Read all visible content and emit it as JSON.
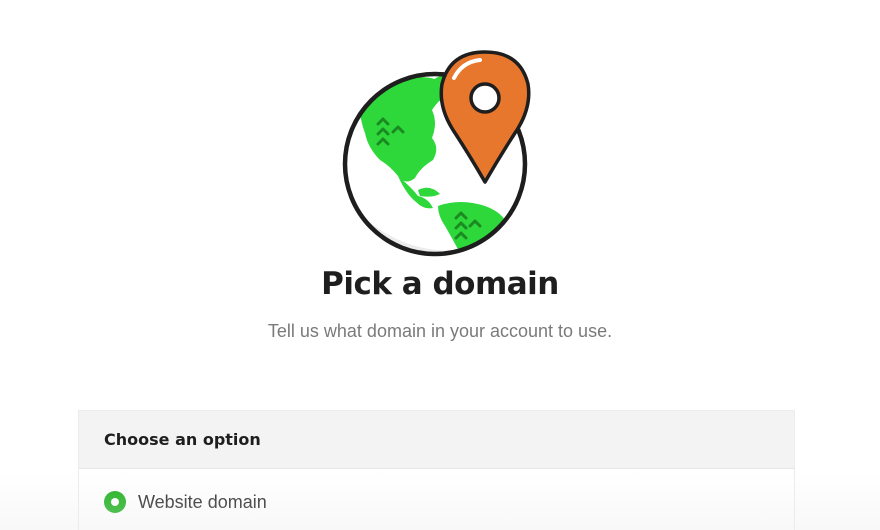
{
  "hero": {
    "icon": "globe-location-pin-icon",
    "colors": {
      "land": "#2fd83a",
      "pin": "#e8772e",
      "outline": "#1e1e1e"
    }
  },
  "header": {
    "title": "Pick a domain",
    "subtitle": "Tell us what domain in your account to use."
  },
  "options": {
    "title": "Choose an option",
    "items": [
      {
        "label": "Website domain",
        "selected": true
      }
    ],
    "accent": "#1bb01b"
  }
}
